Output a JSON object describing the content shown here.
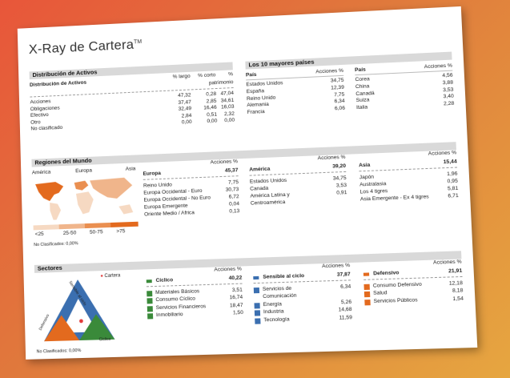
{
  "title": "X-Ray de Cartera",
  "title_mark": "TM",
  "activos": {
    "section": "Distribución de Activos",
    "subtitle": "Distribución de Activos",
    "headers": [
      "% largo",
      "% corto",
      "%",
      "patrimonio"
    ],
    "rows": [
      {
        "label": "Acciones",
        "largo": "47,32",
        "corto": "0,28",
        "pat": "47,04"
      },
      {
        "label": "Obligaciones",
        "largo": "37,47",
        "corto": "2,85",
        "pat": "34,61"
      },
      {
        "label": "Efectivo",
        "largo": "32,49",
        "corto": "16,46",
        "pat": "16,03"
      },
      {
        "label": "Otro",
        "largo": "2,84",
        "corto": "0,51",
        "pat": "2,32"
      },
      {
        "label": "No clasificado",
        "largo": "0,00",
        "corto": "0,00",
        "pat": "0,00"
      }
    ]
  },
  "paises": {
    "section": "Los 10 mayores países",
    "col_label": "País",
    "col_value": "Acciones %",
    "left": [
      {
        "label": "Estados Unidos",
        "value": "34,75"
      },
      {
        "label": "España",
        "value": "12,39"
      },
      {
        "label": "Reino Unido",
        "value": "7,75"
      },
      {
        "label": "Alemania",
        "value": "6,34"
      },
      {
        "label": "Francia",
        "value": "6,06"
      }
    ],
    "right": [
      {
        "label": "Corea",
        "value": "4,56"
      },
      {
        "label": "China",
        "value": "3,88"
      },
      {
        "label": "Canadá",
        "value": "3,53"
      },
      {
        "label": "Suiza",
        "value": "3,40"
      },
      {
        "label": "Italia",
        "value": "2,28"
      }
    ]
  },
  "regiones": {
    "section": "Regiones del Mundo",
    "map_labels": [
      "América",
      "Europa",
      "Asia"
    ],
    "legend": [
      "<25",
      "25-50",
      "50-75",
      ">75"
    ],
    "legend_colors": [
      "#f6d9c2",
      "#f0b58b",
      "#ea8f50",
      "#e36a1e"
    ],
    "no_clas": "No Clasificados: 0,00%",
    "col_value": "Acciones %",
    "europa": {
      "label": "Europa",
      "total": "45,37",
      "rows": [
        {
          "label": "Reino Unido",
          "value": "7,75"
        },
        {
          "label": "Europa Occidental - Euro",
          "value": "30,73"
        },
        {
          "label": "Europa Occidental - No Euro",
          "value": "6,72"
        },
        {
          "label": "Europa Emergente",
          "value": "0,04"
        },
        {
          "label": "Oriente Medio / Africa",
          "value": "0,13"
        }
      ]
    },
    "america": {
      "label": "América",
      "total": "39,20",
      "rows": [
        {
          "label": "Estados Unidos",
          "value": "34,75"
        },
        {
          "label": "Canada",
          "value": "3,53"
        },
        {
          "label": "América Latina y",
          "value": "0,91"
        },
        {
          "label": "Centroamérica",
          "value": ""
        }
      ]
    },
    "asia": {
      "label": "Asia",
      "total": "15,44",
      "rows": [
        {
          "label": "Japón",
          "value": "1,96"
        },
        {
          "label": "Australasia",
          "value": "0,95"
        },
        {
          "label": "Los 4 tigres",
          "value": "5,81"
        },
        {
          "label": "Asia Emergente - Ex 4 tigres",
          "value": "6,71"
        }
      ]
    }
  },
  "sectores": {
    "section": "Sectores",
    "cartera": "Cartera",
    "triangle_labels": [
      "Sensible al ciclo",
      "Defensivo",
      "Ciclico"
    ],
    "no_clas": "No Clasificados: 0,00%",
    "col_value": "Acciones %",
    "ciclico": {
      "label": "Cíclico",
      "total": "40,22",
      "rows": [
        {
          "label": "Materiales Básicos",
          "value": "3,51"
        },
        {
          "label": "Consumo Cíclico",
          "value": "16,74"
        },
        {
          "label": "Servicios Financieros",
          "value": "18,47"
        },
        {
          "label": "Inmobiliario",
          "value": "1,50"
        }
      ]
    },
    "sensible": {
      "label": "Sensible al ciclo",
      "total": "37,87",
      "rows": [
        {
          "label": "Servicios de",
          "value": "6,34"
        },
        {
          "label": "Comunicación",
          "value": ""
        },
        {
          "label": "Energía",
          "value": "5,26"
        },
        {
          "label": "Industria",
          "value": "14,68"
        },
        {
          "label": "Tecnología",
          "value": "11,59"
        }
      ]
    },
    "defensivo": {
      "label": "Defensivo",
      "total": "21,91",
      "rows": [
        {
          "label": "Consumo Defensivo",
          "value": "12,18"
        },
        {
          "label": "Salud",
          "value": "8,18"
        },
        {
          "label": "Servicios Públicos",
          "value": "1,54"
        }
      ]
    }
  }
}
